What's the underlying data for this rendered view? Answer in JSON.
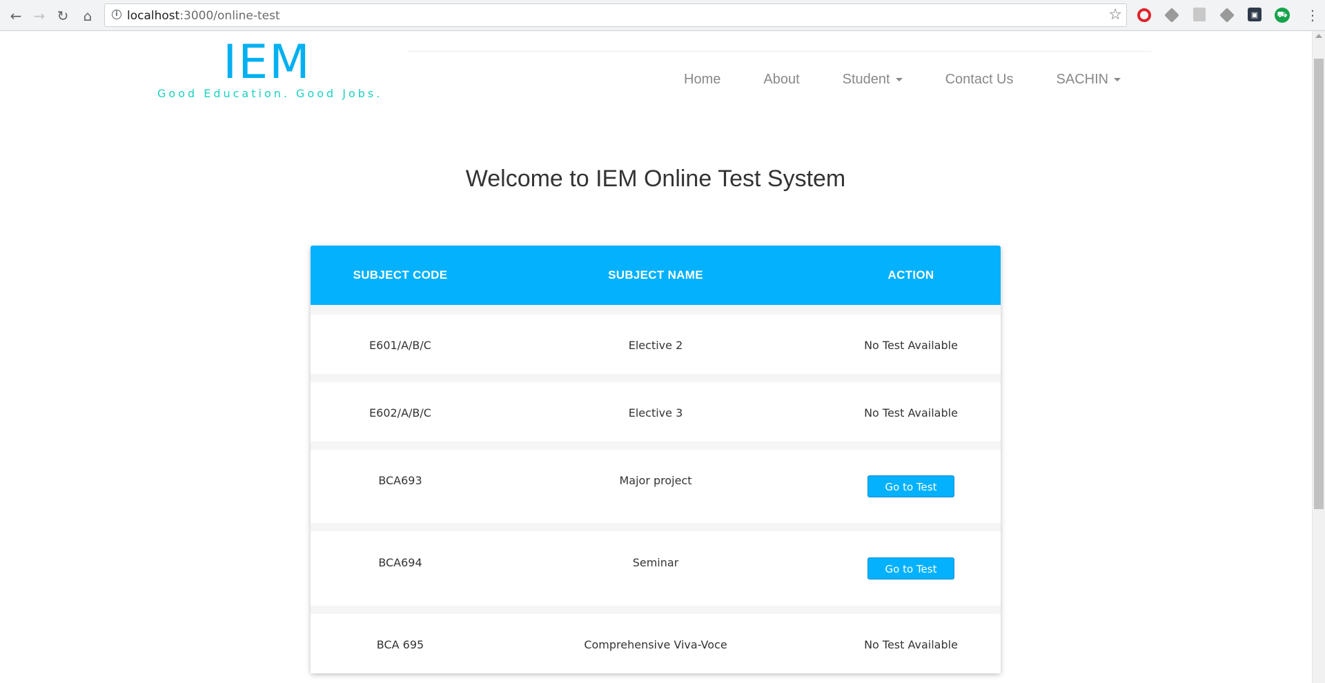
{
  "browser": {
    "url_host": "localhost",
    "url_path": ":3000/online-test",
    "back_icon": "arrow-left",
    "forward_icon": "arrow-right",
    "reload_icon": "reload",
    "home_icon": "home",
    "info_icon": "info-circle",
    "star_icon": "star",
    "extensions": [
      "opera-icon",
      "cube-extension-icon",
      "pdf-extension-icon",
      "cube-extension-icon",
      "dark-extension-icon",
      "shopping-cart-extension-icon"
    ]
  },
  "site": {
    "logo_title": "IEM",
    "logo_tagline": "Good Education. Good Jobs.",
    "brand_color": "#03b0f0",
    "tagline_color": "#1bd0c0",
    "nav": [
      {
        "label": "Home"
      },
      {
        "label": "About"
      },
      {
        "label": "Student",
        "dropdown": true
      },
      {
        "label": "Contact Us"
      },
      {
        "label": "SACHIN",
        "dropdown": true
      }
    ]
  },
  "main": {
    "title": "Welcome to IEM Online Test System",
    "header_color": "#03b1fc",
    "table": {
      "columns": [
        "SUBJECT CODE",
        "SUBJECT NAME",
        "ACTION"
      ],
      "rows": [
        {
          "code": "E601/A/B/C",
          "name": "Elective 2",
          "action": "No Test Available",
          "has_test": false
        },
        {
          "code": "E602/A/B/C",
          "name": "Elective 3",
          "action": "No Test Available",
          "has_test": false
        },
        {
          "code": "BCA693",
          "name": "Major project",
          "action": "Go to Test",
          "has_test": true
        },
        {
          "code": "BCA694",
          "name": "Seminar",
          "action": "Go to Test",
          "has_test": true
        },
        {
          "code": "BCA 695",
          "name": "Comprehensive Viva-Voce",
          "action": "No Test Available",
          "has_test": false
        }
      ]
    }
  }
}
